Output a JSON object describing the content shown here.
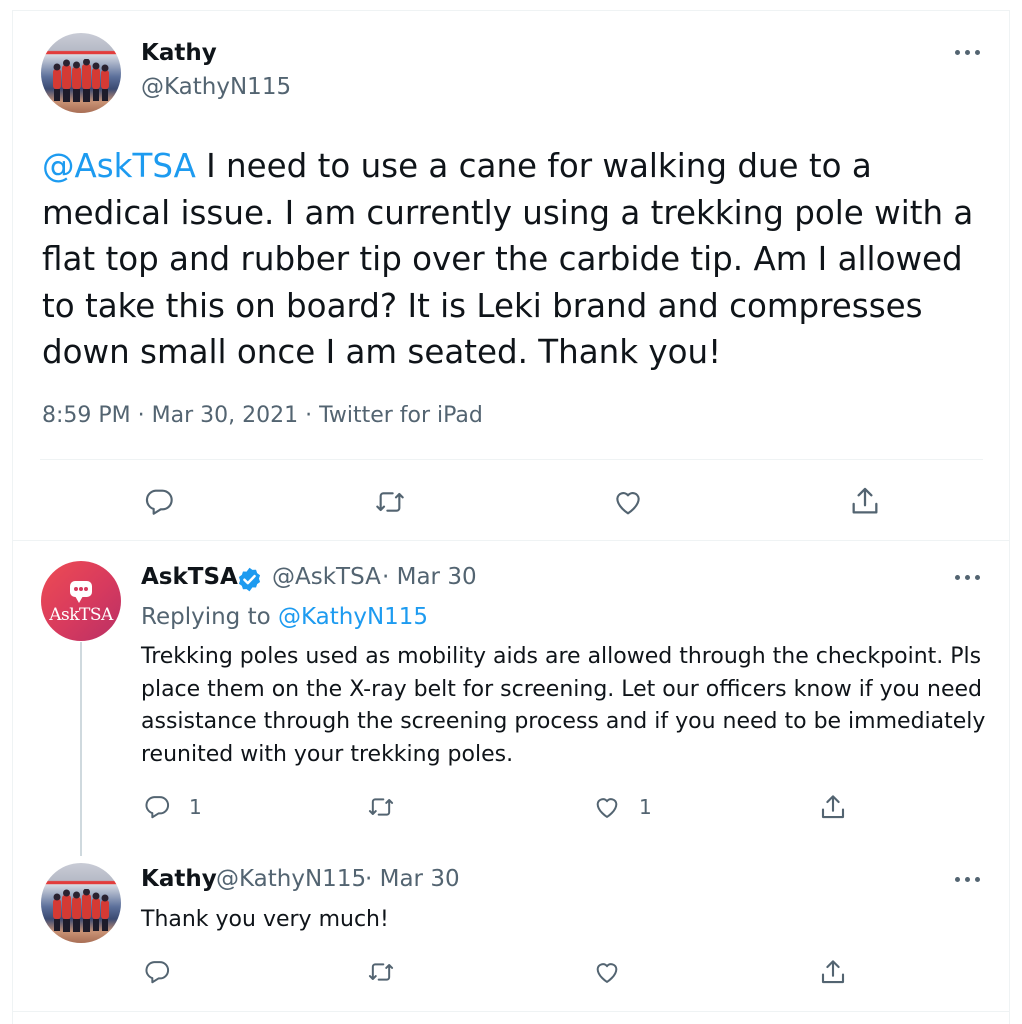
{
  "main_tweet": {
    "author_name": "Kathy",
    "author_handle": "@KathyN115",
    "mention": "@AskTSA",
    "body": " I need to use a cane for walking due to a medical issue. I am currently using a trekking pole with a flat top and rubber tip over the carbide tip. Am I allowed to take this on board? It is Leki brand and compresses down small once I am seated. Thank you!",
    "timestamp": "8:59 PM · Mar 30, 2021 · Twitter for iPad",
    "actions": {
      "reply_icon": "reply-icon",
      "retweet_icon": "retweet-icon",
      "like_icon": "heart-icon",
      "share_icon": "share-icon"
    }
  },
  "reply_1": {
    "author_name": "AskTSA",
    "verified_icon": "verified-badge-icon",
    "author_handle": "@AskTSA",
    "date": "· Mar 30",
    "replying_prefix": "Replying to",
    "replying_handle": "@KathyN115",
    "avatar_text": "AskTSA",
    "body": "Trekking poles used as mobility aids are allowed through the checkpoint. Pls place them on the X-ray belt for screening. Let our officers know if you need assistance through the screening process and if you need to be immediately reunited with your trekking poles.",
    "reply_count": "1",
    "like_count": "1"
  },
  "reply_2": {
    "author_name": "Kathy",
    "author_handle": "@KathyN115",
    "date": "· Mar 30",
    "body": "Thank you very much!"
  },
  "colors": {
    "accent": "#1d9bf0",
    "text": "#0f1419",
    "muted": "#536471",
    "divider": "#eff3f4"
  }
}
